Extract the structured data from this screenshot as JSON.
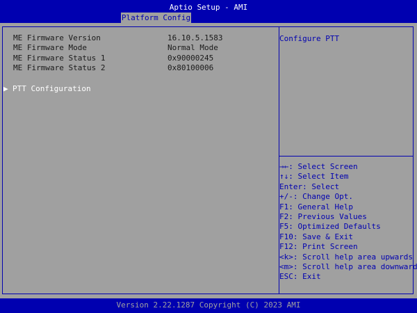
{
  "header": {
    "title": "Aptio Setup - AMI",
    "active_tab": "Platform Config"
  },
  "main": {
    "rows": [
      {
        "label": "ME Firmware Version",
        "value": "16.10.5.1583"
      },
      {
        "label": "ME Firmware Mode",
        "value": "Normal Mode"
      },
      {
        "label": "ME Firmware Status 1",
        "value": "0x90000245"
      },
      {
        "label": "ME Firmware Status 2",
        "value": "0x80100006"
      }
    ],
    "submenu": {
      "arrow": "▶",
      "label": "PTT Configuration"
    }
  },
  "help": {
    "text": "Configure PTT",
    "keys": [
      "→←: Select Screen",
      "↑↓: Select Item",
      "Enter: Select",
      "+/-: Change Opt.",
      "F1: General Help",
      "F2: Previous Values",
      "F5: Optimized Defaults",
      "F10: Save & Exit",
      "F12: Print Screen",
      "<k>: Scroll help area upwards",
      "<m>: Scroll help area downwards",
      "ESC: Exit"
    ]
  },
  "footer": {
    "text": "Version 2.22.1287 Copyright (C) 2023 AMI"
  },
  "colors": {
    "background": "#a0a0a0",
    "accent_blue": "#0000b0",
    "highlight": "#ffffff"
  }
}
